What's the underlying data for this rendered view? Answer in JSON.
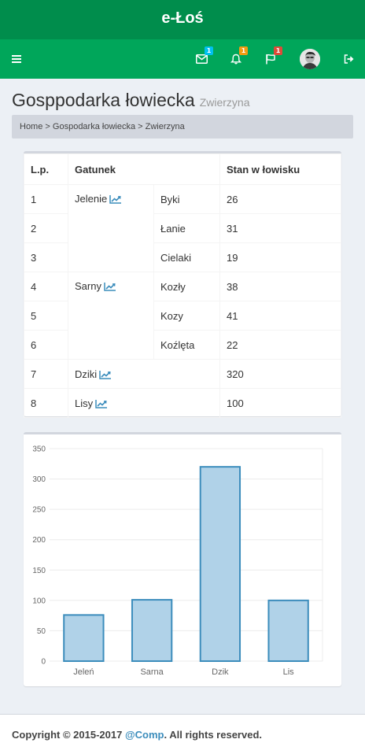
{
  "app": {
    "title": "e-Łoś"
  },
  "navbar": {
    "badges": {
      "mail": "1",
      "bell": "1",
      "flag": "1"
    },
    "badge_colors": {
      "mail": "#00c0ef",
      "bell": "#f39c12",
      "flag": "#dd4b39"
    }
  },
  "page": {
    "title": "Gosppodarka łowiecka",
    "subtitle": "Zwierzyna"
  },
  "breadcrumb": {
    "home": "Home",
    "sep1": ">",
    "section": "Gospodarka łowiecka",
    "sep2": ">",
    "current": "Zwierzyna"
  },
  "table": {
    "headers": {
      "lp": "L.p.",
      "gatunek": "Gatunek",
      "stan": "Stan w łowisku"
    },
    "rows": [
      {
        "lp": "1",
        "group": "Jelenie",
        "sub": "Byki",
        "stan": "26"
      },
      {
        "lp": "2",
        "sub": "Łanie",
        "stan": "31"
      },
      {
        "lp": "3",
        "sub": "Cielaki",
        "stan": "19"
      },
      {
        "lp": "4",
        "group": "Sarny",
        "sub": "Kozły",
        "stan": "38"
      },
      {
        "lp": "5",
        "sub": "Kozy",
        "stan": "41"
      },
      {
        "lp": "6",
        "sub": "Koźlęta",
        "stan": "22"
      },
      {
        "lp": "7",
        "group": "Dziki",
        "stan": "320"
      },
      {
        "lp": "8",
        "group": "Lisy",
        "stan": "100"
      }
    ]
  },
  "chart_data": {
    "type": "bar",
    "categories": [
      "Jeleń",
      "Sarna",
      "Dzik",
      "Lis"
    ],
    "values": [
      76,
      101,
      320,
      100
    ],
    "yticks": [
      "0",
      "50",
      "100",
      "150",
      "200",
      "250",
      "300",
      "350"
    ],
    "ylim": [
      0,
      350
    ],
    "grid": true,
    "bar_fill": "#b0d2e8",
    "bar_stroke": "#3c8dbc"
  },
  "footer": {
    "copyright": "Copyright © 2015-2017 ",
    "company": "@Comp",
    "rights": ". All rights reserved."
  }
}
